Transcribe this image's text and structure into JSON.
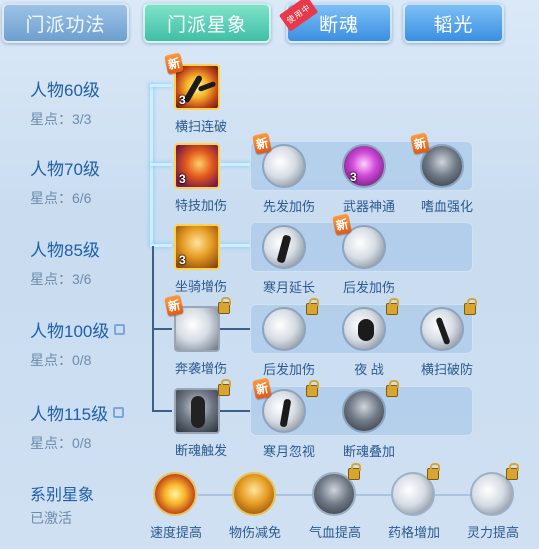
{
  "tabs": [
    {
      "label": "门派功法"
    },
    {
      "label": "门派星象"
    },
    {
      "label": "断魂",
      "badge": "使用中"
    },
    {
      "label": "韬光"
    }
  ],
  "levels": [
    {
      "name": "人物60级",
      "stars": "星点：3/3",
      "locked": false
    },
    {
      "name": "人物70级",
      "stars": "星点：6/6",
      "locked": false
    },
    {
      "name": "人物85级",
      "stars": "星点：3/6",
      "locked": false
    },
    {
      "name": "人物100级",
      "stars": "星点：0/8",
      "locked": true
    },
    {
      "name": "人物115级",
      "stars": "星点：0/8",
      "locked": true
    }
  ],
  "skills": {
    "row1": [
      {
        "label": "横扫连破",
        "count": "3",
        "new_badge": "新"
      }
    ],
    "row2": [
      {
        "label": "特技加伤",
        "count": "3"
      },
      {
        "label": "先发加伤",
        "new_badge": "新"
      },
      {
        "label": "武器神通",
        "count": "3"
      },
      {
        "label": "嗜血强化",
        "new_badge": "新"
      }
    ],
    "row3": [
      {
        "label": "坐骑增伤",
        "count": "3"
      },
      {
        "label": "寒月延长"
      },
      {
        "label": "后发加伤",
        "new_badge": "新"
      }
    ],
    "row4": [
      {
        "label": "奔袭增伤",
        "new_badge": "新"
      },
      {
        "label": "后发加伤"
      },
      {
        "label": "夜 战"
      },
      {
        "label": "横扫破防"
      }
    ],
    "row5": [
      {
        "label": "断魂触发"
      },
      {
        "label": "寒月忽视",
        "new_badge": "新"
      },
      {
        "label": "断魂叠加"
      }
    ]
  },
  "system": {
    "title": "系别星象",
    "status": "已激活",
    "nodes": [
      {
        "label": "速度提高"
      },
      {
        "label": "物伤减免"
      },
      {
        "label": "气血提高"
      },
      {
        "label": "药格增加"
      },
      {
        "label": "灵力提高"
      }
    ]
  },
  "colors": {
    "tab_active": "#3fbfa6",
    "tab_blue": "#3a8ee3",
    "level_text": "#1f5fa8",
    "badge_new": "#e05a18",
    "icon_border_active": "#ffd24a"
  }
}
